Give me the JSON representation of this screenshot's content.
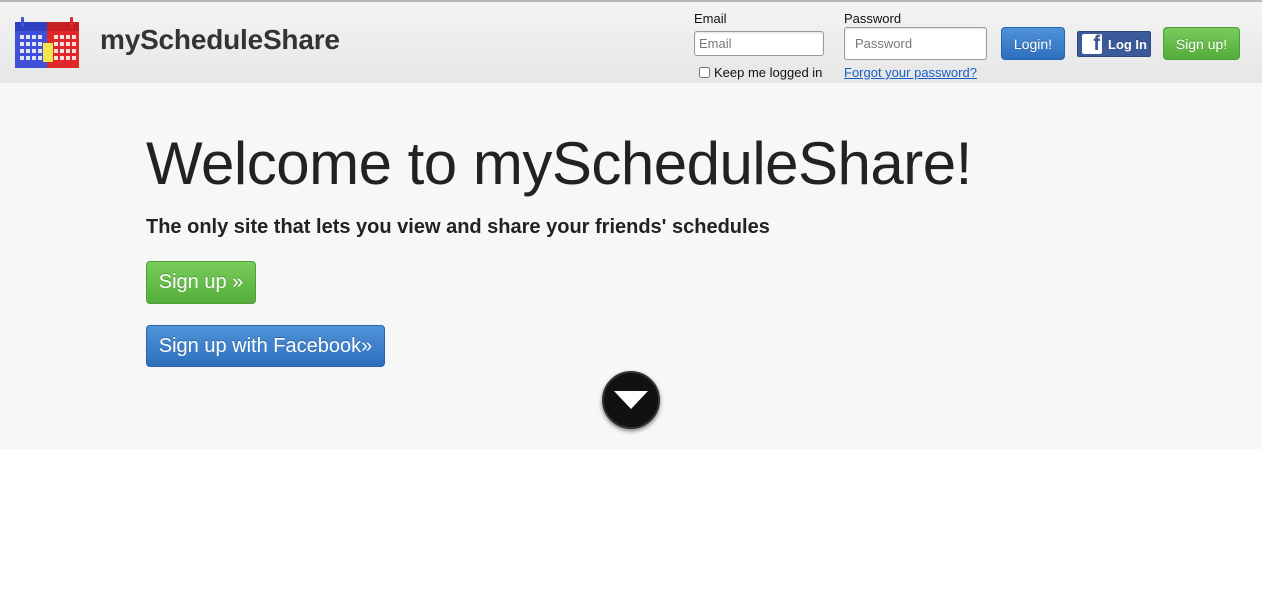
{
  "brand": {
    "name": "myScheduleShare",
    "logo_icon": "calendar-icon"
  },
  "login": {
    "email_label": "Email",
    "email_placeholder": "Email",
    "email_value": "",
    "password_label": "Password",
    "password_placeholder": "Password",
    "password_value": "",
    "remember_label": "Keep me logged in",
    "forgot_label": "Forgot your password?",
    "login_button": "Login!",
    "facebook_login": "Log In",
    "signup_button": "Sign up!"
  },
  "hero": {
    "title": "Welcome to myScheduleShare!",
    "subtitle": "The only site that lets you view and share your friends' schedules",
    "signup_button": "Sign up »",
    "facebook_signup_button": "Sign up with Facebook»",
    "scroll_icon": "chevron-down-icon"
  },
  "colors": {
    "primary_blue": "#3a7fcb",
    "success_green": "#63bb47",
    "facebook_blue": "#3b5a99"
  }
}
